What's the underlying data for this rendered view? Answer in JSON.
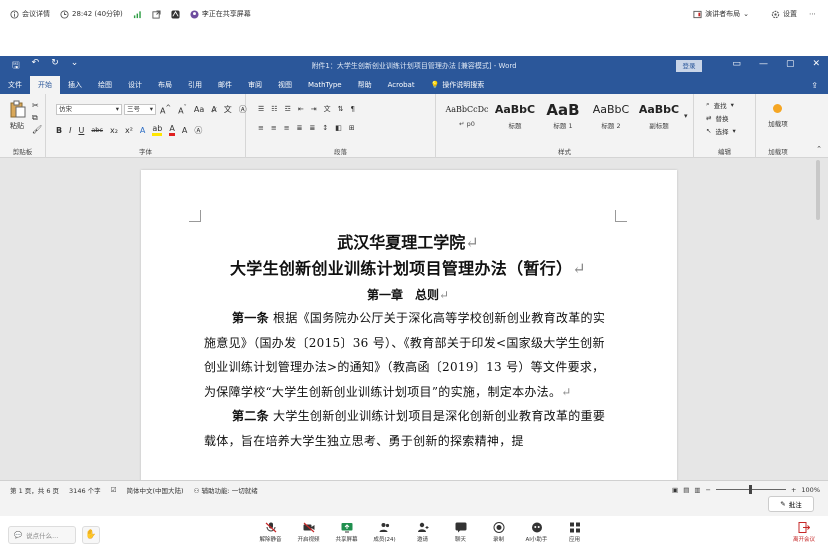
{
  "meeting_top": {
    "details": "会议详情",
    "timer": "28:42 (40分钟)",
    "sharer": "李正在共享屏幕",
    "presenter_layout": "演讲者布局",
    "settings": "设置"
  },
  "word": {
    "doc_title": "附件1：大学生创新创业训练计划项目管理办法 [兼容模式] - Word",
    "login": "登录",
    "tabs": [
      "文件",
      "开始",
      "插入",
      "绘图",
      "设计",
      "布局",
      "引用",
      "邮件",
      "审阅",
      "视图",
      "MathType",
      "帮助",
      "Acrobat"
    ],
    "active_tab": "开始",
    "tell_me": "操作说明搜索",
    "ribbon": {
      "paste": "粘贴",
      "clipboard": "剪贴板",
      "font_name": "仿宋",
      "font_size": "三号",
      "font_group": "字体",
      "paragraph_group": "段落",
      "styles_group": "样式",
      "edit_group": "编辑",
      "addin_group": "加载项",
      "find": "查找",
      "replace": "替换",
      "select": "选择",
      "addin": "加载项",
      "styles": [
        {
          "sample": "AaBbCcDc",
          "name": "↵ p0"
        },
        {
          "sample": "AaBbC",
          "name": "标题"
        },
        {
          "sample": "AaB",
          "name": "标题 1"
        },
        {
          "sample": "AaBbC",
          "name": "标题 2"
        },
        {
          "sample": "AaBbC",
          "name": "副标题"
        }
      ]
    },
    "document": {
      "title1": "武汉华夏理工学院",
      "title2": "大学生创新创业训练计划项目管理办法（暂行）",
      "chapter": "第一章　总则",
      "p1_label": "第一条",
      "p1_text": "根据《国务院办公厅关于深化高等学校创新创业教育改革的实施意见》（国办发〔2015〕36 号）、《教育部关于印发<国家级大学生创新创业训练计划管理办法>的通知》（教高函〔2019〕13 号）等文件要求，为保障学校“大学生创新创业训练计划项目”的实施，制定本办法。",
      "p2_label": "第二条",
      "p2_text": "大学生创新创业训练计划项目是深化创新创业教育改革的重要载体，旨在培养大学生独立思考、勇于创新的探索精神，提"
    },
    "status": {
      "page": "第 1 页，共 6 页",
      "words": "3146 个字",
      "language": "简体中文(中国大陆)",
      "accessibility": "辅助功能: 一切就绪",
      "zoom": "100%"
    }
  },
  "annotate": "批注",
  "meeting_bottom": {
    "ask": "说点什么...",
    "tools": [
      {
        "label": "解除静音",
        "icon": "mic-off-icon"
      },
      {
        "label": "开启视频",
        "icon": "video-off-icon"
      },
      {
        "label": "共享屏幕",
        "icon": "share-screen-icon"
      },
      {
        "label": "成员(24)",
        "icon": "members-icon"
      },
      {
        "label": "邀请",
        "icon": "invite-icon"
      },
      {
        "label": "聊天",
        "icon": "chat-icon"
      },
      {
        "label": "录制",
        "icon": "record-icon"
      },
      {
        "label": "AI小助手",
        "icon": "ai-assistant-icon"
      },
      {
        "label": "应用",
        "icon": "apps-icon"
      }
    ],
    "leave": "离开会议"
  },
  "colors": {
    "word_blue": "#2b579a",
    "leave_red": "#c62828",
    "accent_orange": "#f5a623"
  }
}
